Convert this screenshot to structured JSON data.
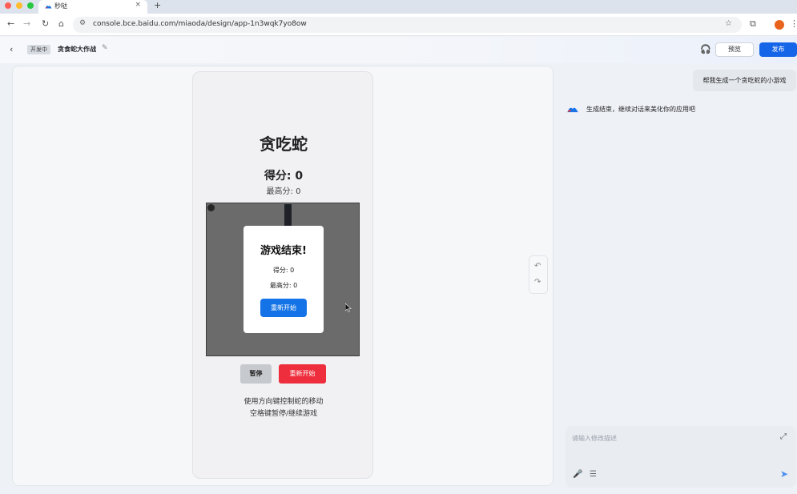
{
  "browser": {
    "tab_title": "秒哒",
    "tab_close": "×",
    "new_tab": "+",
    "url": "console.bce.baidu.com/miaoda/design/app-1n3wqk7yo8ow",
    "nav": {
      "back": "←",
      "forward": "→",
      "reload": "↻",
      "home": "⌂"
    },
    "icons": {
      "site_info": "⚙",
      "star": "☆",
      "extensions": "⧉",
      "menu": "⋮"
    }
  },
  "app": {
    "back_icon": "‹",
    "status_badge": "开发中",
    "title": "贪食蛇大作战",
    "edit_icon": "✎",
    "support_icon": "🎧",
    "preview_label": "预览",
    "publish_label": "发布",
    "accent": "#1565e8"
  },
  "game": {
    "title": "贪吃蛇",
    "score_text": "得分: 0",
    "highscore_text": "最高分: 0",
    "modal": {
      "title": "游戏结束!",
      "score_text": "得分: 0",
      "highscore_text": "最高分: 0",
      "restart_label": "重新开始"
    },
    "pause_label": "暂停",
    "restart_label": "重新开始",
    "help_line1": "使用方向键控制蛇的移动",
    "help_line2": "空格键暂停/继续游戏"
  },
  "history": {
    "undo_icon": "↶",
    "redo_icon": "↷"
  },
  "chat": {
    "user_message": "帮我生成一个贪吃蛇的小游戏",
    "bot_message": "生成结束，继续对话来美化你的应用吧",
    "input_placeholder": "请输入修改描述",
    "icons": {
      "expand": "⤢",
      "mic": "🎤",
      "list": "☰",
      "send": "➤"
    }
  }
}
